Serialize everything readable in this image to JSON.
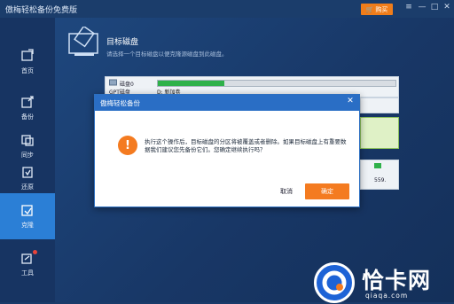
{
  "app": {
    "title": "傲梅轻松备份免费版"
  },
  "titlebar": {
    "buy_label": "购买",
    "controls": [
      "≡",
      "—",
      "□",
      "✕"
    ]
  },
  "sidebar": {
    "items": [
      {
        "label": "首页",
        "icon": "home-icon"
      },
      {
        "label": "备份",
        "icon": "backup-icon"
      },
      {
        "label": "同步",
        "icon": "sync-icon"
      },
      {
        "label": "还原",
        "icon": "restore-icon"
      },
      {
        "label": "克隆",
        "icon": "clone-icon"
      },
      {
        "label": "工具",
        "icon": "tools-icon"
      }
    ],
    "active": "克隆"
  },
  "main": {
    "title": "目标磁盘",
    "subtitle": "请选择一个目标磁盘以便克隆源磁盘到此磁盘。",
    "disk": {
      "name": "磁盘0",
      "type": "GPT磁盘",
      "partition_label": "D: 新加卷",
      "used_fraction": 0.28
    },
    "right_value": "559."
  },
  "dialog": {
    "title": "傲梅轻松备份",
    "message": "执行这个操作后，目标磁盘的分区将被覆盖或者删除。如果目标磁盘上有重要数据我们建议您先备份它们。您确定继续执行吗？",
    "cancel_label": "取消",
    "ok_label": "确定",
    "colors": {
      "header": "#2a6ec5",
      "accent": "#f47b20"
    }
  },
  "watermark": {
    "text": "恰卡网",
    "url": "qiaqa.com"
  }
}
